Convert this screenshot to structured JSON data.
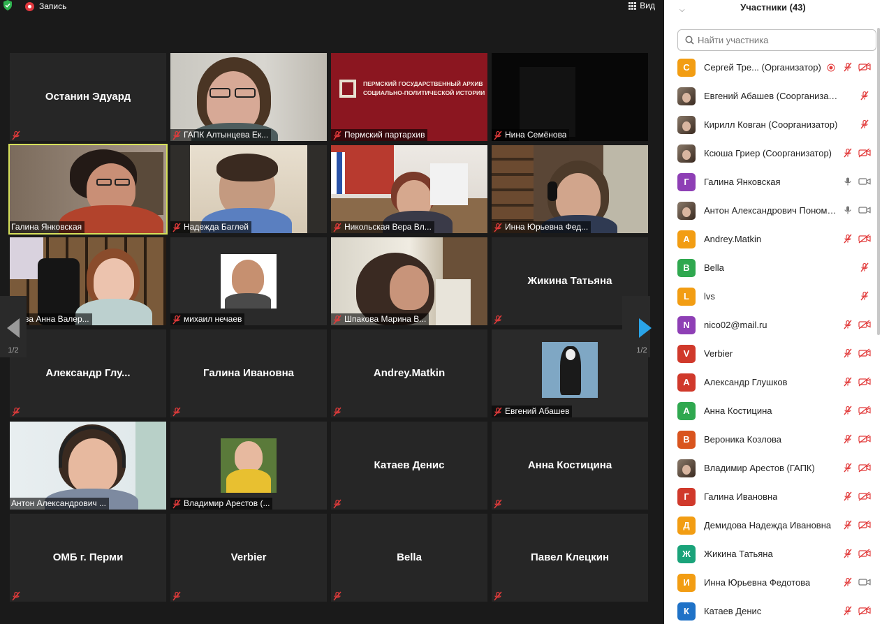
{
  "topbar": {
    "record_label": "Запись",
    "view_label": "Вид"
  },
  "nav": {
    "page_left": "1/2",
    "page_right": "1/2"
  },
  "tiles": [
    {
      "name": "Останин Эдуард",
      "video": false,
      "muted": true
    },
    {
      "name": "ГАПК Алтынцева Ек...",
      "video": true,
      "muted": true
    },
    {
      "name": "Пермский партархив",
      "video": true,
      "muted": true
    },
    {
      "name": "Нина Семёнова",
      "video": true,
      "muted": true
    },
    {
      "name": "Галина Янковская",
      "video": true,
      "muted": false,
      "active": true
    },
    {
      "name": "Надежда Баглей",
      "video": true,
      "muted": true
    },
    {
      "name": "Никольская Вера Вл...",
      "video": true,
      "muted": true
    },
    {
      "name": "Инна Юрьевна Фед...",
      "video": true,
      "muted": true
    },
    {
      "name": "охова Анна Валер...",
      "video": true,
      "muted": false
    },
    {
      "name": "михаил нечаев",
      "video": true,
      "muted": true
    },
    {
      "name": "Шпакова Марина В...",
      "video": true,
      "muted": true
    },
    {
      "name": "Жикина Татьяна",
      "video": false,
      "muted": true
    },
    {
      "name": "Александр  Глу...",
      "video": false,
      "muted": true
    },
    {
      "name": "Галина Ивановна",
      "video": false,
      "muted": true
    },
    {
      "name": "Andrey.Matkin",
      "video": false,
      "muted": true
    },
    {
      "name": "Евгений Абашев",
      "video": true,
      "muted": true
    },
    {
      "name": "Антон Александрович ...",
      "video": true,
      "muted": false
    },
    {
      "name": "Владимир Арестов (...",
      "video": true,
      "muted": true
    },
    {
      "name": "Катаев Денис",
      "video": false,
      "muted": true
    },
    {
      "name": "Анна Костицина",
      "video": false,
      "muted": true
    },
    {
      "name": "ОМБ г. Перми",
      "video": false,
      "muted": true
    },
    {
      "name": "Verbier",
      "video": false,
      "muted": true
    },
    {
      "name": "Bella",
      "video": false,
      "muted": true
    },
    {
      "name": "Павел Клецкин",
      "video": false,
      "muted": true
    }
  ],
  "archive_sign": {
    "line1": "ПЕРМСКИЙ ГОСУДАРСТВЕННЫЙ АРХИВ",
    "line2": "СОЦИАЛЬНО-ПОЛИТИЧЕСКОЙ ИСТОРИИ"
  },
  "sidebar": {
    "title": "Участники (43)",
    "search_placeholder": "Найти участника",
    "participants": [
      {
        "name": "Сергей Тре...  (Организатор)",
        "avatar": "С",
        "color": "#f29d13",
        "mic": "muted",
        "cam": "off",
        "recording": true
      },
      {
        "name": "Евгений Абашев (Соорганизатор)",
        "avatar": "",
        "photo": true,
        "mic": "muted",
        "cam": "none"
      },
      {
        "name": "Кирилл Ковган (Соорганизатор)",
        "avatar": "",
        "photo": true,
        "mic": "muted",
        "cam": "none"
      },
      {
        "name": "Ксюша Гриер (Соорганизатор)",
        "avatar": "",
        "photo": true,
        "mic": "muted",
        "cam": "off"
      },
      {
        "name": "Галина Янковская",
        "avatar": "Г",
        "color": "#8e3fb5",
        "mic": "on",
        "cam": "on"
      },
      {
        "name": "Антон Александрович Пономарев",
        "avatar": "",
        "photo": true,
        "mic": "on",
        "cam": "on"
      },
      {
        "name": "Andrey.Matkin",
        "avatar": "A",
        "color": "#f29d13",
        "mic": "muted",
        "cam": "off"
      },
      {
        "name": "Bella",
        "avatar": "B",
        "color": "#2fa84f",
        "mic": "muted",
        "cam": "none"
      },
      {
        "name": "lvs",
        "avatar": "L",
        "color": "#f29d13",
        "mic": "muted",
        "cam": "none"
      },
      {
        "name": "nico02@mail.ru",
        "avatar": "N",
        "color": "#8e3fb5",
        "mic": "muted",
        "cam": "off"
      },
      {
        "name": "Verbier",
        "avatar": "V",
        "color": "#d0392b",
        "mic": "muted",
        "cam": "off"
      },
      {
        "name": "Александр Глушков",
        "avatar": "А",
        "color": "#d0392b",
        "mic": "muted",
        "cam": "off"
      },
      {
        "name": "Анна Костицина",
        "avatar": "А",
        "color": "#2fa84f",
        "mic": "muted",
        "cam": "off"
      },
      {
        "name": "Вероника Козлова",
        "avatar": "В",
        "color": "#d9541e",
        "mic": "muted",
        "cam": "off"
      },
      {
        "name": "Владимир Арестов (ГАПК)",
        "avatar": "",
        "photo": true,
        "mic": "muted",
        "cam": "off"
      },
      {
        "name": "Галина Ивановна",
        "avatar": "Г",
        "color": "#d0392b",
        "mic": "muted",
        "cam": "off"
      },
      {
        "name": "Демидова Надежда Ивановна",
        "avatar": "Д",
        "color": "#f29d13",
        "mic": "muted",
        "cam": "off"
      },
      {
        "name": "Жикина Татьяна",
        "avatar": "Ж",
        "color": "#1aa37a",
        "mic": "muted",
        "cam": "off"
      },
      {
        "name": "Инна Юрьевна Федотова",
        "avatar": "И",
        "color": "#f29d13",
        "mic": "muted",
        "cam": "on"
      },
      {
        "name": "Катаев Денис",
        "avatar": "К",
        "color": "#1f72c7",
        "mic": "muted",
        "cam": "off"
      }
    ]
  }
}
